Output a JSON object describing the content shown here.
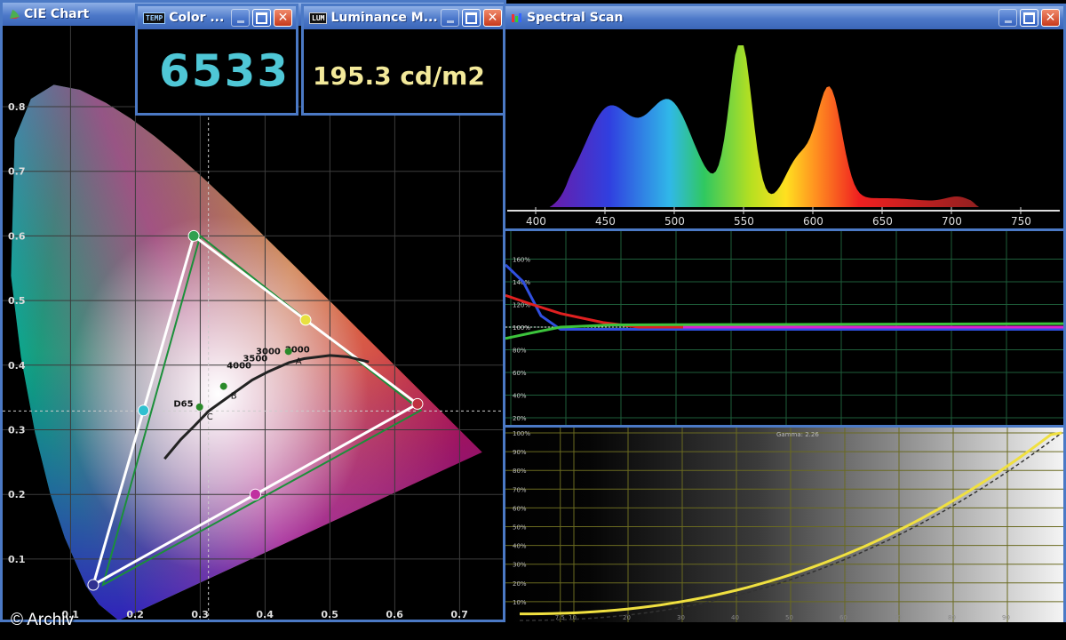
{
  "windows": {
    "cie": {
      "title": "CIE Chart",
      "icon": "cie-chart-icon"
    },
    "color_temp": {
      "title": "Color ...",
      "icon_label": "TEMP",
      "value": "6533",
      "value_color": "#4fc7d6"
    },
    "luminance": {
      "title": "Luminance M...",
      "icon_label": "LUM",
      "value": "195.3 cd/m2",
      "value_color": "#f3e99a"
    },
    "spectral": {
      "title": "Spectral Scan",
      "icon": "spectrum-icon"
    }
  },
  "cie_chart": {
    "x_ticks": [
      "0.1",
      "0.2",
      "0.3",
      "0.4",
      "0.5",
      "0.6",
      "0.7"
    ],
    "y_ticks": [
      "0.1",
      "0.2",
      "0.3",
      "0.4",
      "0.5",
      "0.6",
      "0.7",
      "0.8"
    ],
    "gamut_triangle": {
      "red": [
        0.635,
        0.34
      ],
      "green": [
        0.29,
        0.6
      ],
      "blue": [
        0.135,
        0.06
      ]
    },
    "reference_triangle": {
      "red": [
        0.64,
        0.33
      ],
      "green": [
        0.3,
        0.6
      ],
      "blue": [
        0.15,
        0.06
      ]
    },
    "white_point": [
      0.3127,
      0.329
    ],
    "cct_labels": [
      "2000",
      "3000",
      "3500",
      "4000",
      "D65"
    ],
    "illuminant_labels": [
      "A",
      "B",
      "C"
    ]
  },
  "spectral_chart": {
    "x_ticks": [
      "400",
      "450",
      "500",
      "550",
      "600",
      "650",
      "700",
      "750"
    ],
    "peaks_nm": [
      450,
      495,
      545,
      590,
      612
    ]
  },
  "rgb_balance_chart": {
    "y_ticks": [
      "160%",
      "140%",
      "120%",
      "100%",
      "80%",
      "60%",
      "40%",
      "20%"
    ],
    "series_colors": {
      "red": "#e02020",
      "green": "#3cc43c",
      "blue": "#3050e0",
      "magenta": "#e020d0"
    }
  },
  "gamma_chart": {
    "label": "Gamma: 2.26",
    "y_ticks": [
      "100%",
      "90%",
      "80%",
      "70%",
      "60%",
      "50%",
      "40%",
      "30%",
      "20%",
      "10%"
    ],
    "x_ticks": [
      "7.5",
      "10",
      "20",
      "30",
      "40",
      "50",
      "60",
      "70",
      "80",
      "90"
    ],
    "curve_color": "#f0e040"
  },
  "watermark": "© Archiv"
}
